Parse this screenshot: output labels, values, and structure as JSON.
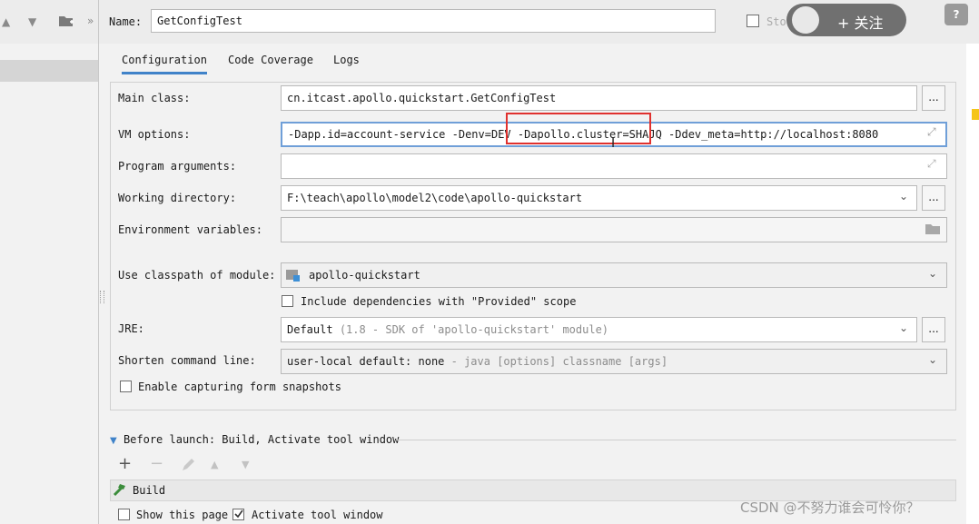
{
  "header": {
    "name_label": "Name:",
    "name_value": "GetConfigTest",
    "store_label": "Sto",
    "follow_label": "+ 关注",
    "help_label": "?"
  },
  "tabs": [
    {
      "label": "Configuration"
    },
    {
      "label": "Code Coverage"
    },
    {
      "label": "Logs"
    }
  ],
  "config": {
    "main_class_label": "Main class:",
    "main_class_value": "cn.itcast.apollo.quickstart.GetConfigTest",
    "vm_options_label": "VM options:",
    "vm_options_value": "-Dapp.id=account-service -Denv=DEV -Dapollo.cluster=SHAJQ -Ddev_meta=http://localhost:8080",
    "program_args_label": "Program arguments:",
    "program_args_value": "",
    "working_dir_label": "Working directory:",
    "working_dir_value": "F:\\teach\\apollo\\model2\\code\\apollo-quickstart",
    "env_vars_label": "Environment variables:",
    "env_vars_value": "",
    "classpath_label": "Use classpath of module:",
    "classpath_value": "apollo-quickstart",
    "include_deps_label": "Include dependencies with \"Provided\" scope",
    "include_deps_checked": false,
    "jre_label": "JRE:",
    "jre_value": "Default",
    "jre_hint": "(1.8 - SDK of 'apollo-quickstart' module)",
    "shorten_label": "Shorten command line:",
    "shorten_value": "user-local default: none",
    "shorten_hint": "- java [options] classname [args]",
    "snapshots_label": "Enable capturing form snapshots",
    "snapshots_checked": false,
    "dots_label": "..."
  },
  "before_launch": {
    "header": "Before launch: Build, Activate tool window",
    "items": [
      {
        "label": "Build"
      }
    ],
    "show_page_label": "Show this page",
    "show_page_checked": false,
    "activate_label": "Activate tool window",
    "activate_checked": true
  },
  "watermark": "CSDN @不努力谁会可怜你？",
  "colors": {
    "accent": "#4083c9",
    "highlight": "#e0312e",
    "build_icon": "#3c8d3c"
  }
}
